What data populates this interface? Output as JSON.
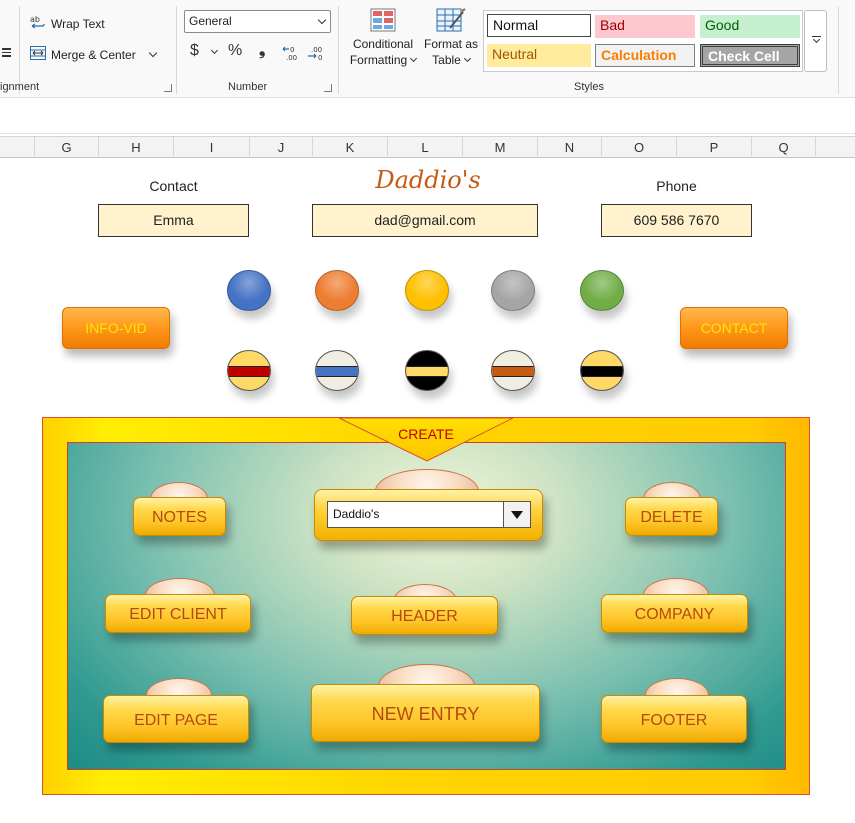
{
  "ribbon": {
    "alignment": {
      "wrap_text": "Wrap Text",
      "merge_center": "Merge & Center",
      "group_label": "ignment"
    },
    "number": {
      "format_value": "General",
      "currency_symbol": "$",
      "percent_symbol": "%",
      "comma_symbol": "❟",
      "increase_decimal": "←.0 .00",
      "decrease_decimal": ".00 →.0",
      "group_label": "Number"
    },
    "styles": {
      "conditional_formatting": [
        "Conditional",
        "Formatting"
      ],
      "format_as_table": [
        "Format as",
        "Table"
      ],
      "cells": {
        "normal": "Normal",
        "bad": "Bad",
        "good": "Good",
        "neutral": "Neutral",
        "calculation": "Calculation",
        "check_cell": "Check Cell"
      },
      "group_label": "Styles"
    }
  },
  "columns": [
    "G",
    "H",
    "I",
    "J",
    "K",
    "L",
    "M",
    "N",
    "O",
    "P",
    "Q"
  ],
  "sheet": {
    "brand": "Daddio's",
    "contact_label": "Contact",
    "contact_value": "Emma",
    "email_value": "dad@gmail.com",
    "phone_label": "Phone",
    "phone_value": "609 586 7670",
    "info_button": "INFO-VID",
    "contact_button": "CONTACT"
  },
  "swatches": {
    "solid": [
      "#4472c4",
      "#ed7d31",
      "#ffc000",
      "#a5a5a5",
      "#70ad47"
    ],
    "banded": [
      {
        "body": "#ffd966",
        "band": "#c00000"
      },
      {
        "body": "#f2ede1",
        "band": "#4472c4"
      },
      {
        "body": "#000000",
        "band": "#ffd966"
      },
      {
        "body": "#f2ede1",
        "band": "#c55a11"
      },
      {
        "body": "#ffd966",
        "band": "#000000"
      }
    ]
  },
  "create": {
    "title": "CREATE",
    "dropdown_value": "Daddio's",
    "buttons": {
      "notes": "NOTES",
      "delete": "DELETE",
      "edit_client": "EDIT CLIENT",
      "header": "HEADER",
      "company": "COMPANY",
      "edit_page": "EDIT PAGE",
      "new_entry": "NEW ENTRY",
      "footer": "FOOTER"
    }
  },
  "colors": {
    "accent_orange": "#ff9a1f",
    "button_gold": "#ffd84a",
    "button_text": "#b54a0f",
    "panel_yellow": "#ffe000",
    "panel_teal": "#2d9990"
  }
}
